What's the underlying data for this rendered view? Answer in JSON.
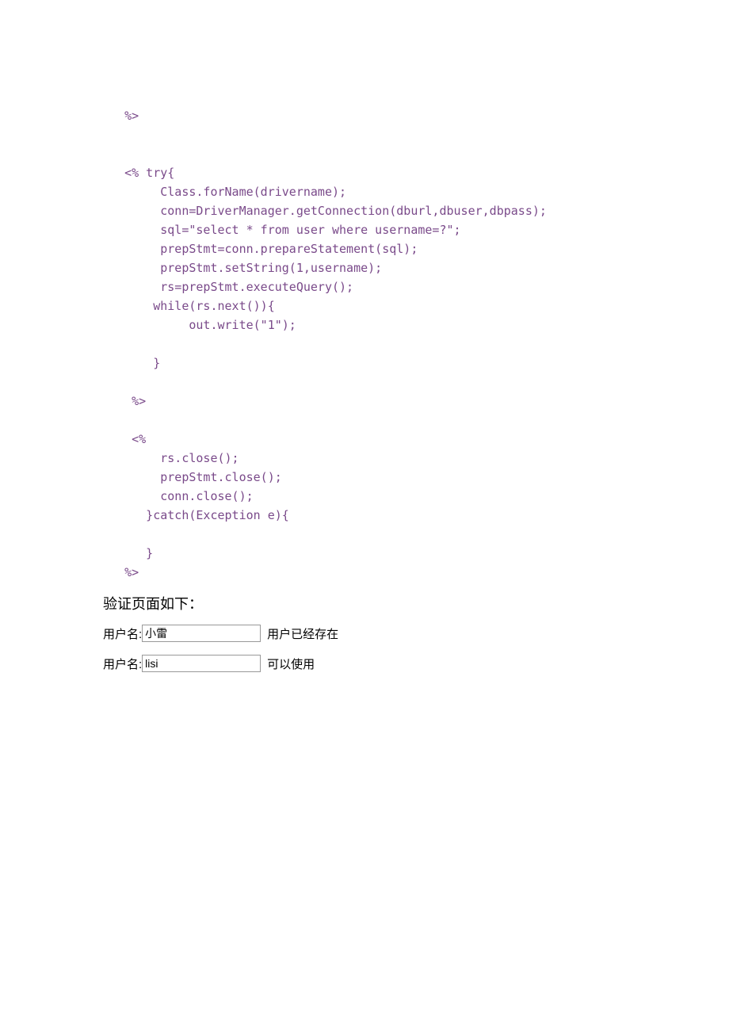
{
  "code": {
    "line1": "   %>",
    "line2": "",
    "line3": "",
    "line4": "   <% try{",
    "line5": "        Class.forName(drivername);",
    "line6": "        conn=DriverManager.getConnection(dburl,dbuser,dbpass);",
    "line7": "        sql=\"select * from user where username=?\";",
    "line8": "        prepStmt=conn.prepareStatement(sql);",
    "line9": "        prepStmt.setString(1,username);",
    "line10": "        rs=prepStmt.executeQuery();",
    "line11": "       while(rs.next()){",
    "line12": "            out.write(\"1\");",
    "line13": "",
    "line14": "       }",
    "line15": "",
    "line16": "    %>",
    "line17": "",
    "line18": "    <%",
    "line19": "        rs.close();",
    "line20": "        prepStmt.close();",
    "line21": "        conn.close();",
    "line22": "      }catch(Exception e){",
    "line23": "",
    "line24": "      }",
    "line25": "   %>"
  },
  "section_title": "验证页面如下：",
  "form": {
    "row1": {
      "label": "用户名:",
      "value": "小雷",
      "status": "用户已经存在"
    },
    "row2": {
      "label": "用户名:",
      "value": "lisi",
      "status": "可以使用"
    }
  }
}
